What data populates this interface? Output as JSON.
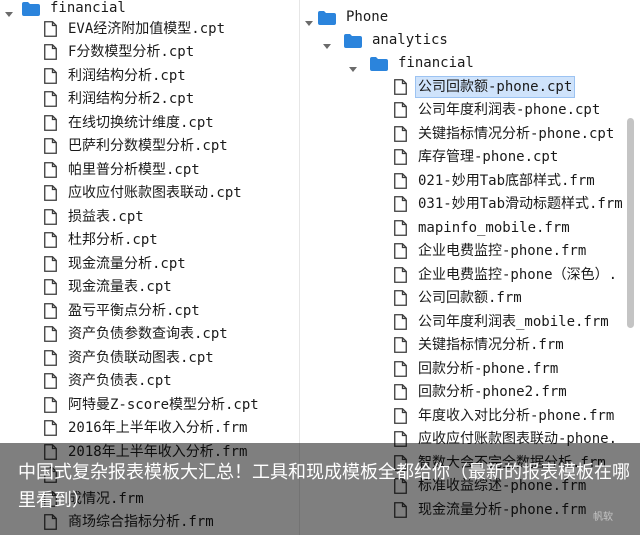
{
  "left_tree": {
    "folder": "financial",
    "files": [
      "EVA经济附加值模型.cpt",
      "F分数模型分析.cpt",
      "利润结构分析.cpt",
      "利润结构分析2.cpt",
      "在线切换统计维度.cpt",
      "巴萨利分数模型分析.cpt",
      "帕里普分析模型.cpt",
      "应收应付账款图表联动.cpt",
      "损益表.cpt",
      "杜邦分析.cpt",
      "现金流量分析.cpt",
      "现金流量表.cpt",
      "盈亏平衡点分析.cpt",
      "资产负债参数查询表.cpt",
      "资产负债联动图表.cpt",
      "资产负债表.cpt",
      "阿特曼Z-score模型分析.cpt",
      "2016年上半年收入分析.frm",
      "2018年上半年收入分析.frm",
      "",
      "成情况.frm",
      "商场综合指标分析.frm"
    ]
  },
  "right_tree": {
    "root": "Phone",
    "sub": "analytics",
    "folder": "financial",
    "files": [
      "公司回款额-phone.cpt",
      "公司年度利润表-phone.cpt",
      "关键指标情况分析-phone.cpt",
      "库存管理-phone.cpt",
      "021-妙用Tab底部样式.frm",
      "031-妙用Tab滑动标题样式.frm",
      "mapinfo_mobile.frm",
      "企业电费监控-phone.frm",
      "企业电费监控-phone（深色）.",
      "公司回款额.frm",
      "公司年度利润表_mobile.frm",
      "关键指标情况分析.frm",
      "回款分析-phone.frm",
      "回款分析-phone2.frm",
      "年度收入对比分析-phone.frm",
      "应收应付账款图表联动-phone.",
      "智数大会不完全数据分析.frm",
      "标准收益综述-phone.frm",
      "现金流量分析-phone.frm"
    ],
    "selected_index": 0
  },
  "caption": {
    "text": "中国式复杂报表模板大汇总！工具和现成模板全都给你（最新的报表模板在哪里看到）"
  },
  "watermark": "帆软",
  "colors": {
    "folder": "#2b84dc",
    "file_border": "#3a3a3a",
    "selection": "#cfe3fb",
    "overlay": "rgba(0,0,0,0.5)"
  }
}
